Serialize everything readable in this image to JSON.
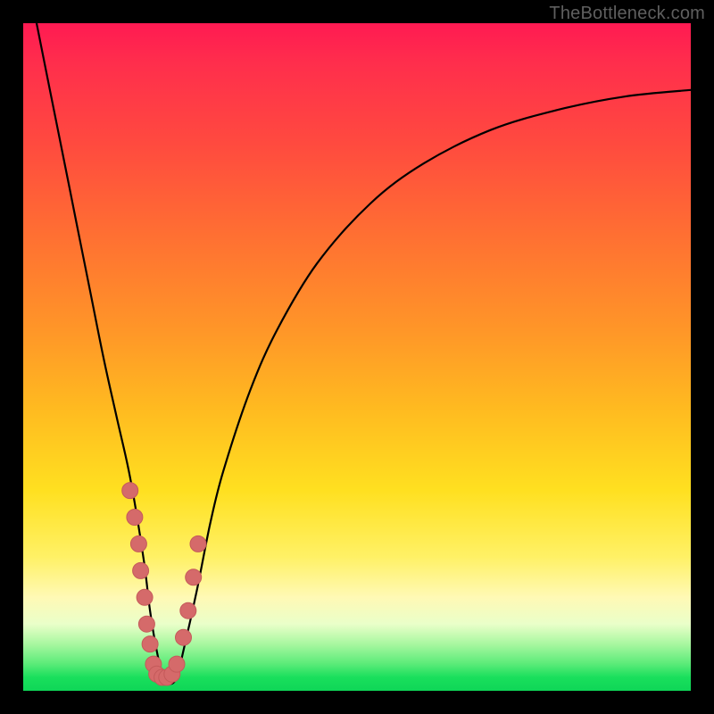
{
  "watermark": "TheBottleneck.com",
  "colors": {
    "curve": "#000000",
    "dot_fill": "#d56a6a",
    "dot_stroke": "#c45a5a",
    "frame": "#000000"
  },
  "chart_data": {
    "type": "line",
    "title": "",
    "xlabel": "",
    "ylabel": "",
    "xlim": [
      0,
      100
    ],
    "ylim": [
      0,
      100
    ],
    "series": [
      {
        "name": "bottleneck-curve",
        "x": [
          2,
          4,
          6,
          8,
          10,
          12,
          14,
          16,
          18,
          19,
          20,
          21,
          22,
          23,
          24,
          26,
          28,
          30,
          34,
          38,
          44,
          52,
          60,
          70,
          80,
          90,
          100
        ],
        "y": [
          100,
          90,
          80,
          70,
          60,
          50,
          41,
          32,
          20,
          12,
          6,
          2,
          1,
          2,
          6,
          15,
          25,
          33,
          45,
          54,
          64,
          73,
          79,
          84,
          87,
          89,
          90
        ]
      }
    ],
    "markers": [
      {
        "name": "left-cluster",
        "x": [
          16.0,
          16.7,
          17.3,
          17.6,
          18.2,
          18.5,
          19.0,
          19.5,
          20.0,
          20.8,
          21.5
        ],
        "y": [
          30,
          26,
          22,
          18,
          14,
          10,
          7,
          4,
          2.5,
          2,
          2
        ]
      },
      {
        "name": "right-cluster",
        "x": [
          22.3,
          23.0,
          24.0,
          24.7,
          25.5,
          26.2
        ],
        "y": [
          2.5,
          4,
          8,
          12,
          17,
          22
        ]
      }
    ],
    "annotations": []
  }
}
